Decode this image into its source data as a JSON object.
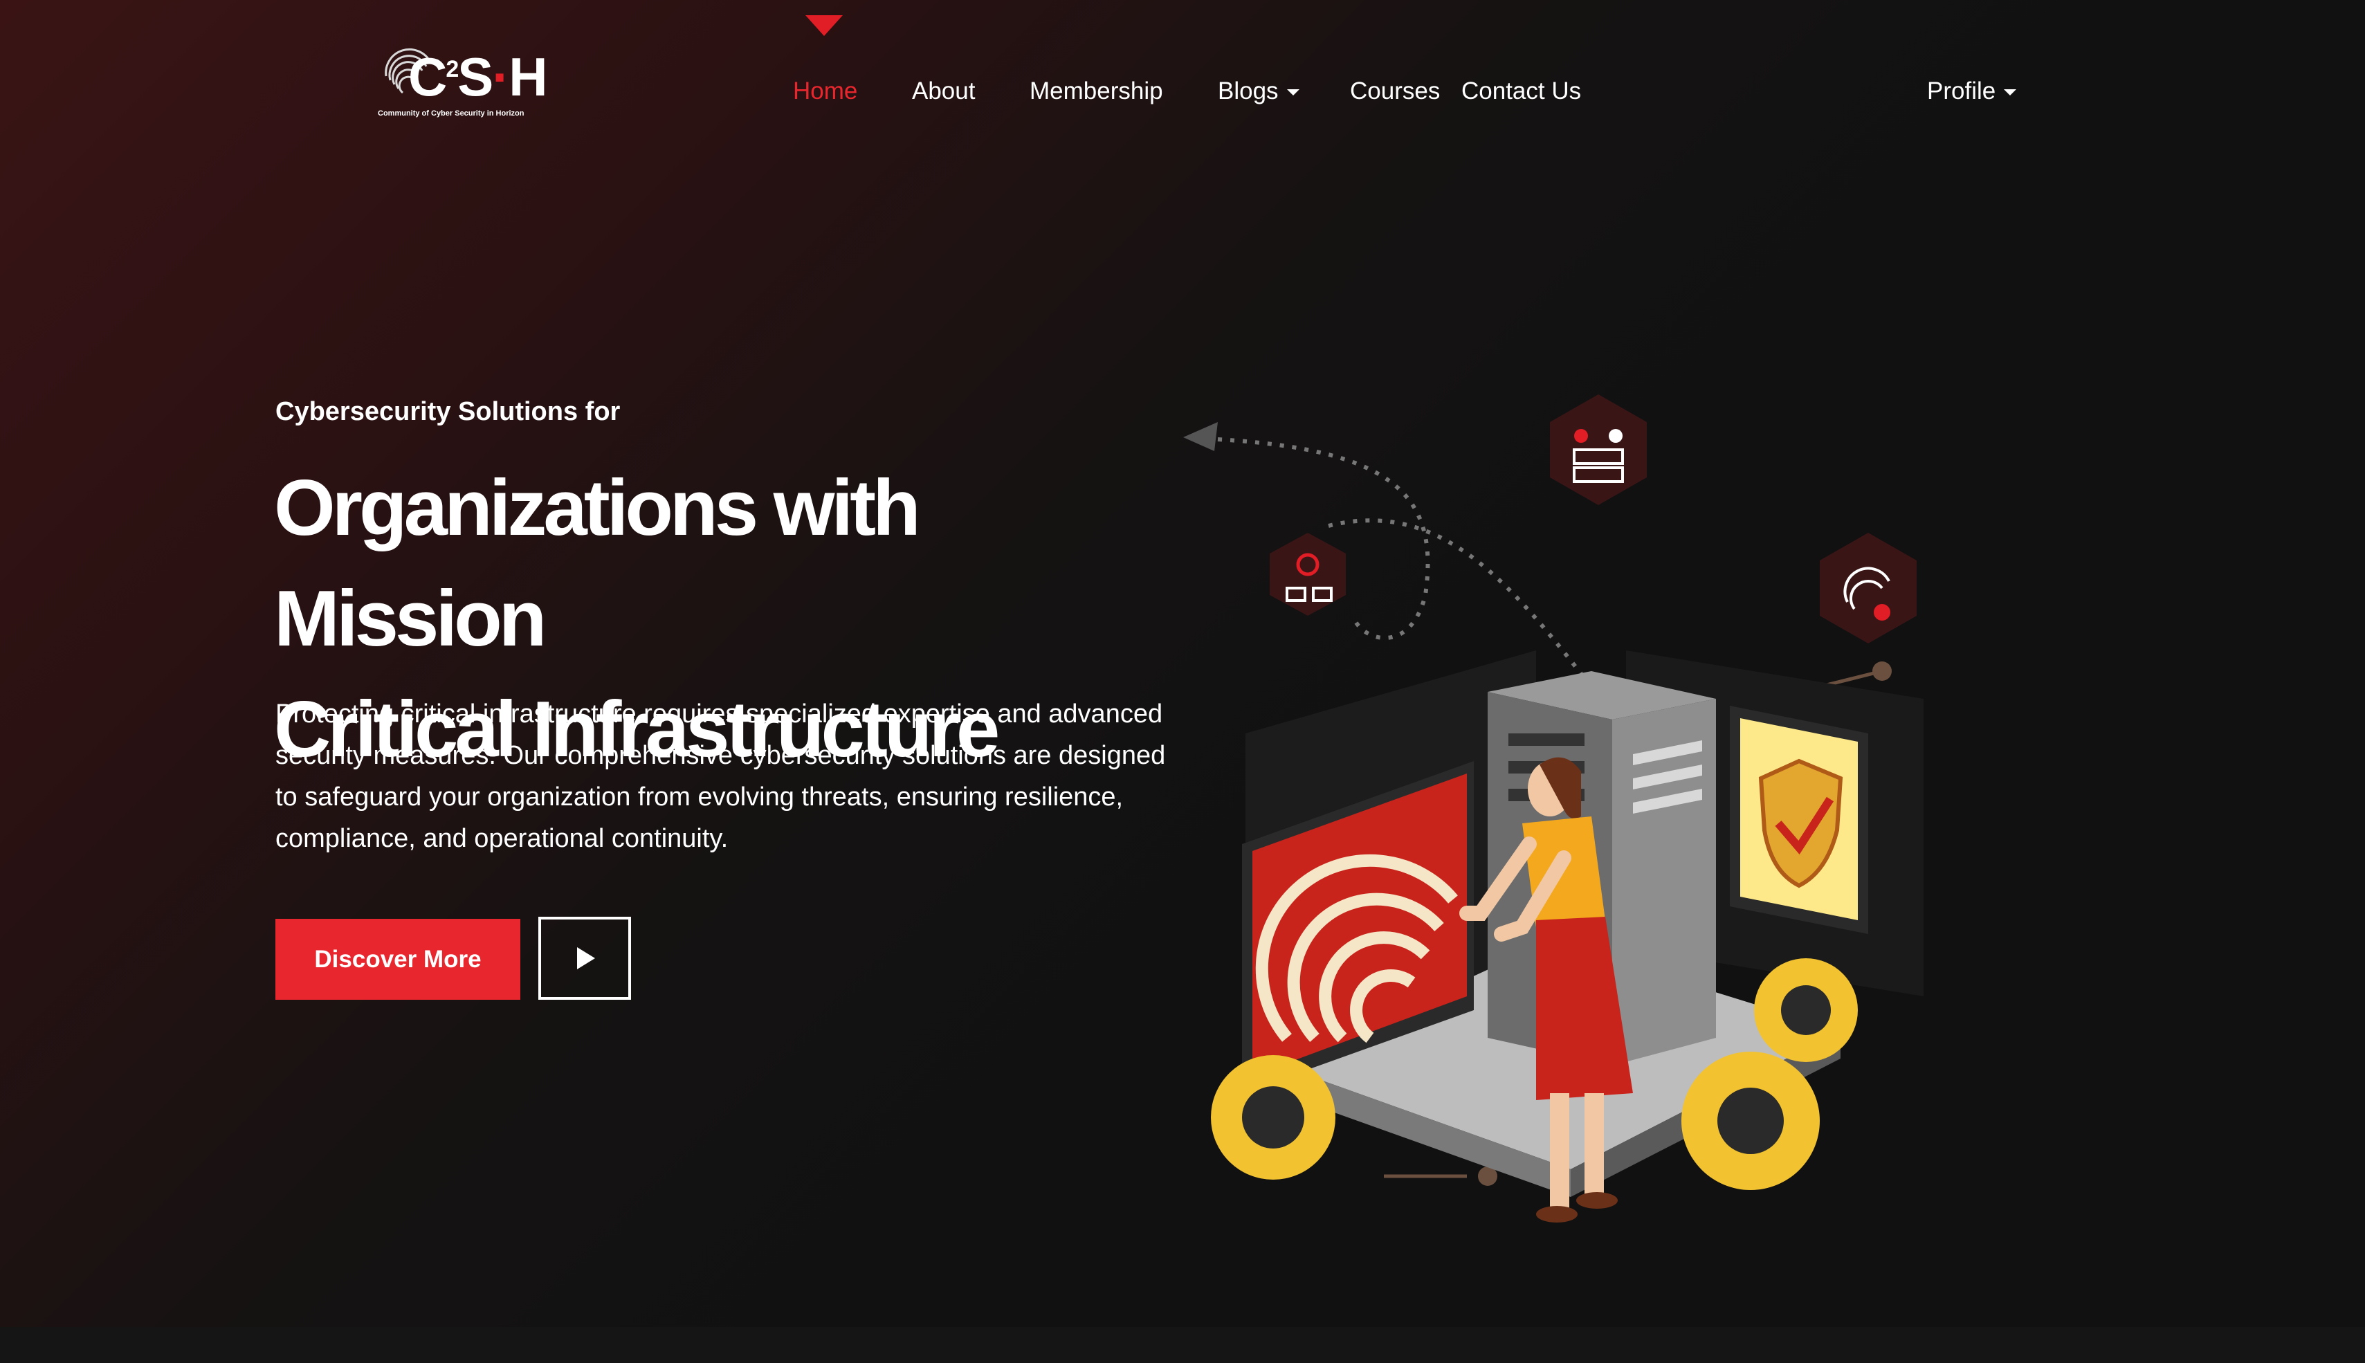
{
  "brand": {
    "logo_prefix": "C",
    "logo_superscript": "2",
    "logo_suffix_s": "S",
    "logo_suffix_h": "H",
    "logo_tagline": "Community of Cyber Security in Horizon"
  },
  "nav": {
    "items": [
      {
        "label": "Home",
        "active": true
      },
      {
        "label": "About"
      },
      {
        "label": "Membership"
      },
      {
        "label": "Blogs",
        "dropdown": true
      },
      {
        "label": "Courses"
      },
      {
        "label": "Contact Us"
      }
    ],
    "profile_label": "Profile"
  },
  "hero": {
    "eyebrow": "Cybersecurity Solutions for",
    "headline_line1": "Organizations with Mission",
    "headline_line2": "Critical Infrastructure",
    "description": "Protecting critical infrastructure requires specialized expertise and advanced security measures. Our comprehensive cybersecurity solutions are designed to safeguard your organization from evolving threats, ensuring resilience, compliance, and operational continuity.",
    "primary_button": "Discover More",
    "play_icon": "play-icon"
  },
  "colors": {
    "accent": "#e8262d",
    "background": "#111111",
    "gradient_dark_red": "#3a1415"
  },
  "icons": [
    "fingerprint-icon",
    "play-icon",
    "chevron-down-icon",
    "network-icon",
    "server-icon",
    "shield-icon"
  ]
}
